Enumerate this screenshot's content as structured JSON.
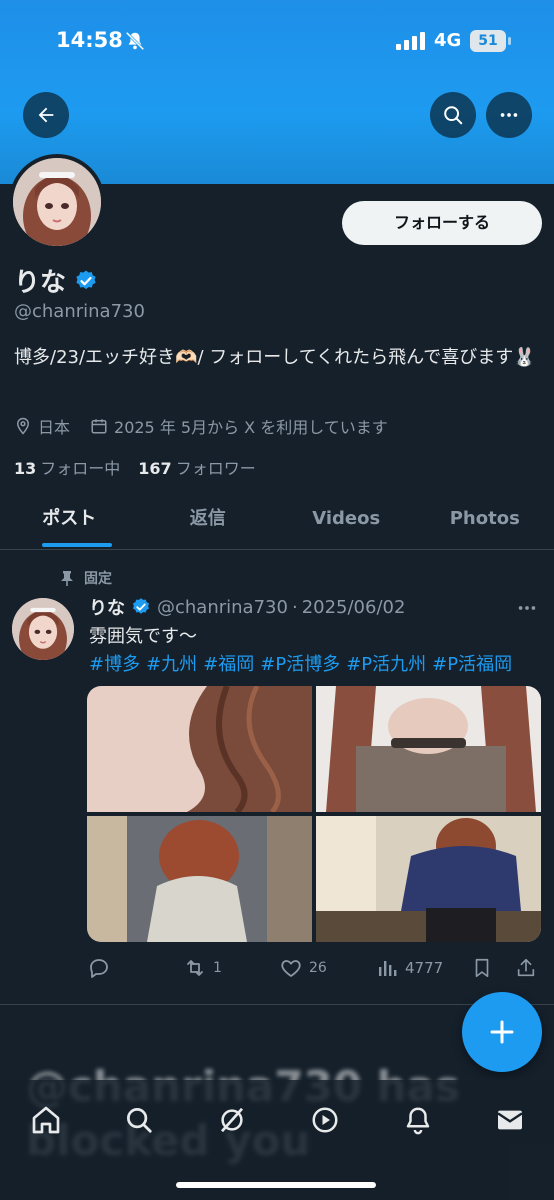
{
  "status_bar": {
    "time": "14:58",
    "network": "4G",
    "battery": "51"
  },
  "profile": {
    "name": "りな",
    "handle": "@chanrina730",
    "follow_label": "フォローする",
    "bio": "博多/23/エッチ好き🫶🏻/ フォローしてくれたら飛んで喜びます🐰",
    "location": "日本",
    "joined": "2025 年 5月から X を利用しています",
    "following_count": "13",
    "following_label": "フォロー中",
    "followers_count": "167",
    "followers_label": "フォロワー"
  },
  "tabs": [
    {
      "label": "ポスト",
      "active": true
    },
    {
      "label": "返信",
      "active": false
    },
    {
      "label": "Videos",
      "active": false
    },
    {
      "label": "Photos",
      "active": false
    }
  ],
  "post": {
    "pinned_label": "固定",
    "author_name": "りな",
    "author_handle": "@chanrina730",
    "date": "2025/06/02",
    "text": "雰囲気です〜",
    "hashtags": [
      "#博多",
      "#九州",
      "#福岡",
      "#P活博多",
      "#P活九州",
      "#P活福岡"
    ],
    "retweets": "1",
    "likes": "26",
    "views": "4777"
  },
  "blocked_text": "@chanrina730 has blocked you",
  "colors": {
    "accent": "#1d9bf0",
    "background": "#15202b",
    "muted": "#8b98a5"
  },
  "nav": [
    "home-icon",
    "search-icon",
    "grok-icon",
    "video-icon",
    "notifications-icon",
    "messages-icon"
  ]
}
